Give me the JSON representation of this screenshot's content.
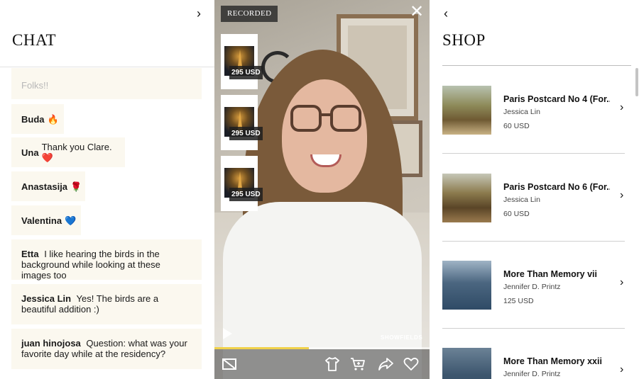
{
  "chat": {
    "title": "CHAT",
    "collapse_icon": "chevron-right-icon",
    "messages": [
      {
        "author": "",
        "text": "Folks!!",
        "faded": true
      },
      {
        "author": "Buda",
        "text": "🔥"
      },
      {
        "author": "Una",
        "text": "Thank you Clare. ❤️"
      },
      {
        "author": "Anastasija",
        "text": "🌹"
      },
      {
        "author": "Valentina",
        "text": "💙"
      },
      {
        "author": "Etta",
        "text": "I like hearing the birds in the background while looking at these images too"
      },
      {
        "author": "Jessica Lin",
        "text": "Yes! The birds are a beautiful addition :)"
      },
      {
        "author": "juan hinojosa",
        "text": "Question: what was your favorite day while at the residency?"
      }
    ]
  },
  "video": {
    "badge": "RECORDED",
    "close_icon": "close-icon",
    "watermark": "SHOWFIELDS",
    "progress": 0.44,
    "thumbnails": [
      {
        "price": "295 USD"
      },
      {
        "price": "295 USD"
      },
      {
        "price": "295 USD"
      }
    ],
    "controls": [
      "subtitles-off-icon",
      "shirt-icon",
      "cart-icon",
      "share-icon",
      "heart-icon"
    ],
    "colors": {
      "progress": "#f1d24b"
    }
  },
  "shop": {
    "title": "SHOP",
    "back_icon": "chevron-left-icon",
    "products": [
      {
        "name": "Paris Postcard No 4 (For...",
        "artist": "Jessica Lin",
        "price": "60 USD"
      },
      {
        "name": "Paris Postcard No 6 (For...",
        "artist": "Jessica Lin",
        "price": "60 USD"
      },
      {
        "name": "More Than Memory vii",
        "artist": "Jennifer D. Printz",
        "price": "125 USD"
      },
      {
        "name": "More Than Memory xxii",
        "artist": "Jennifer D. Printz",
        "price": ""
      }
    ]
  }
}
